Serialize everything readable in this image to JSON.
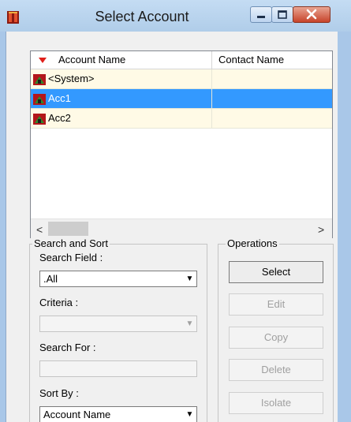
{
  "window": {
    "title": "Select Account",
    "controls": [
      "minimize",
      "maximize",
      "close"
    ]
  },
  "grid": {
    "columns": [
      "Account Name",
      "Contact Name"
    ],
    "rows": [
      {
        "account": "<System>",
        "contact": "",
        "selected": false
      },
      {
        "account": "Acc1",
        "contact": "",
        "selected": true
      },
      {
        "account": "Acc2",
        "contact": "",
        "selected": false
      }
    ],
    "scroll_left": "<",
    "scroll_right": ">"
  },
  "search_sort": {
    "legend": "Search and Sort",
    "search_field_label": "Search Field :",
    "search_field_value": ".All",
    "criteria_label": "Criteria :",
    "criteria_value": "",
    "search_for_label": "Search For :",
    "search_for_value": "",
    "sort_by_label": "Sort By :",
    "sort_by_value": "Account Name"
  },
  "operations": {
    "legend": "Operations",
    "select": "Select",
    "edit": "Edit",
    "copy": "Copy",
    "delete": "Delete",
    "isolate": "Isolate"
  },
  "colors": {
    "selection": "#3399ff",
    "row_background": "#fffae6",
    "title_bar": "#b9d4ee"
  }
}
